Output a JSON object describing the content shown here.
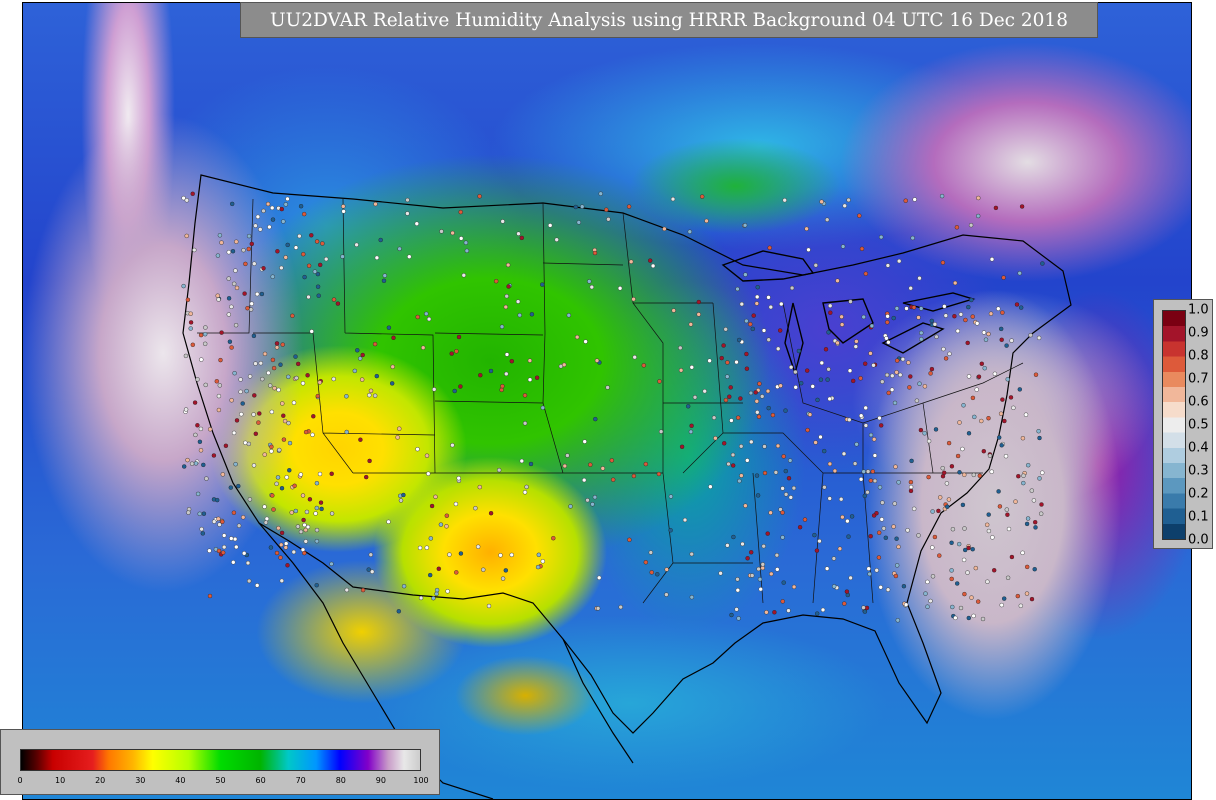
{
  "title": "UU2DVAR Relative Humidity Analysis using HRRR Background 04 UTC 16 Dec 2018",
  "rh_colorbar": {
    "ticks": [
      "0",
      "10",
      "20",
      "30",
      "40",
      "50",
      "60",
      "70",
      "80",
      "90",
      "100"
    ],
    "range": [
      0,
      100
    ],
    "stops": [
      {
        "v": 0,
        "c": "#000000"
      },
      {
        "v": 4,
        "c": "#5a0000"
      },
      {
        "v": 8,
        "c": "#c80000"
      },
      {
        "v": 18,
        "c": "#e61e1e"
      },
      {
        "v": 22,
        "c": "#ff7800"
      },
      {
        "v": 28,
        "c": "#ffb400"
      },
      {
        "v": 33,
        "c": "#ffff00"
      },
      {
        "v": 42,
        "c": "#b4ff00"
      },
      {
        "v": 50,
        "c": "#00dc00"
      },
      {
        "v": 60,
        "c": "#00b400"
      },
      {
        "v": 67,
        "c": "#00c8c8"
      },
      {
        "v": 74,
        "c": "#0096ff"
      },
      {
        "v": 80,
        "c": "#0000ff"
      },
      {
        "v": 87,
        "c": "#8200c8"
      },
      {
        "v": 92,
        "c": "#c89bc8"
      },
      {
        "v": 96,
        "c": "#e8e8e8"
      },
      {
        "v": 100,
        "c": "#cccccc"
      }
    ]
  },
  "obs_colorbar": {
    "ticks": [
      "1.0",
      "0.9",
      "0.8",
      "0.7",
      "0.6",
      "0.5",
      "0.4",
      "0.3",
      "0.2",
      "0.1",
      "0.0"
    ],
    "range": [
      0,
      1
    ],
    "colors_top_to_bottom": [
      "#7a0012",
      "#a3142a",
      "#c8332f",
      "#dd5a3a",
      "#e98a5e",
      "#f1b79a",
      "#f6dccb",
      "#ededed",
      "#d3dfe8",
      "#afcde0",
      "#86b5d0",
      "#5c98bf",
      "#3a7bab",
      "#1f5f92",
      "#0d3f6b"
    ]
  }
}
